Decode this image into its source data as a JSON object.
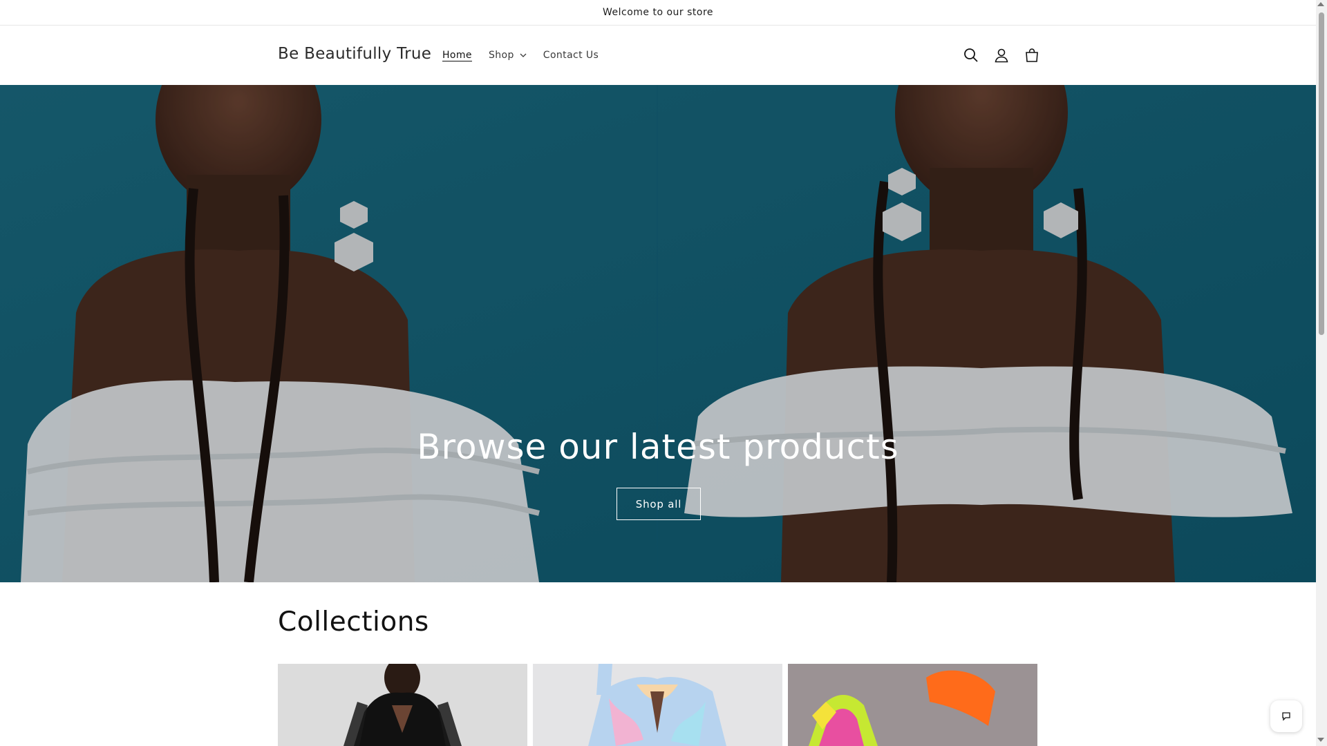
{
  "announcement": {
    "text": "Welcome to our store"
  },
  "header": {
    "logo": "Be Beautifully True",
    "nav": [
      {
        "label": "Home",
        "active": true
      },
      {
        "label": "Shop",
        "has_dropdown": true
      },
      {
        "label": "Contact Us"
      }
    ],
    "icons": [
      "search-icon",
      "account-icon",
      "cart-icon"
    ]
  },
  "hero": {
    "title": "Browse our latest products",
    "button_label": "Shop all",
    "background_color": "#1f6f85"
  },
  "collections": {
    "title": "Collections",
    "cards": [
      {
        "image": "woman-in-black-top"
      },
      {
        "image": "woman-in-pastel-print-dress"
      },
      {
        "image": "neon-heel-and-orange-bangle"
      }
    ]
  },
  "chat": {
    "icon": "chat-icon"
  }
}
